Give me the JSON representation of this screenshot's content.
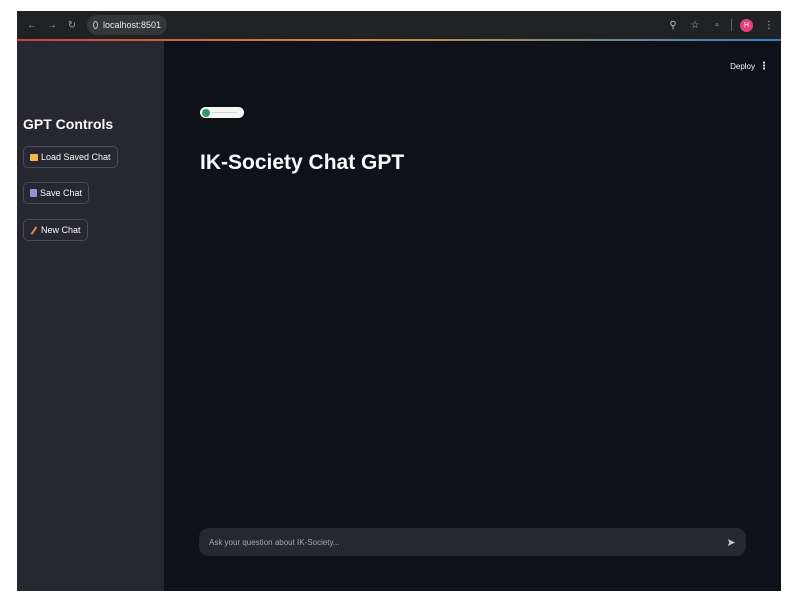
{
  "browser": {
    "url": "localhost:8501",
    "profile_initial": "H"
  },
  "sidebar": {
    "title": "GPT Controls",
    "buttons": [
      {
        "label": "Load Saved Chat",
        "icon": "folder-icon"
      },
      {
        "label": "Save Chat",
        "icon": "floppy-disk-icon"
      },
      {
        "label": "New Chat",
        "icon": "broom-icon"
      }
    ]
  },
  "header": {
    "deploy_label": "Deploy"
  },
  "main": {
    "title": "IK-Society Chat GPT"
  },
  "chat": {
    "placeholder": "Ask your question about IK-Society..."
  },
  "colors": {
    "app_bg": "#0e1117",
    "sidebar_bg": "#262730",
    "text": "#fafafa",
    "accent": "#ff4b4b"
  }
}
